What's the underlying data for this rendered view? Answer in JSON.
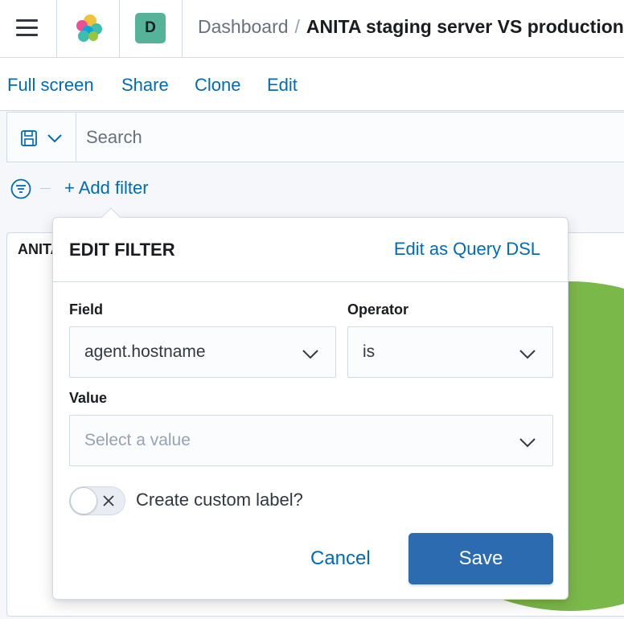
{
  "header": {
    "avatar_letter": "D",
    "breadcrumb_root": "Dashboard",
    "breadcrumb_separator": "/",
    "breadcrumb_current": "ANITA staging server VS production s"
  },
  "topnav": {
    "full_screen": "Full screen",
    "share": "Share",
    "clone": "Clone",
    "edit": "Edit"
  },
  "querybar": {
    "search_placeholder": "Search",
    "saved_query_icon": "save-icon"
  },
  "filters": {
    "add_filter": "+ Add filter"
  },
  "panel": {
    "title": "ANITA",
    "pie_color": "#7bb84a"
  },
  "popover": {
    "title": "EDIT FILTER",
    "edit_dsl": "Edit as Query DSL",
    "field_label": "Field",
    "field_value": "agent.hostname",
    "operator_label": "Operator",
    "operator_value": "is",
    "value_label": "Value",
    "value_placeholder": "Select a value",
    "custom_label_text": "Create custom label?",
    "custom_label_on": false,
    "cancel": "Cancel",
    "save": "Save"
  },
  "colors": {
    "link": "#006bb8",
    "primary_button": "#2d6bb0",
    "avatar_bg": "#54b399"
  }
}
